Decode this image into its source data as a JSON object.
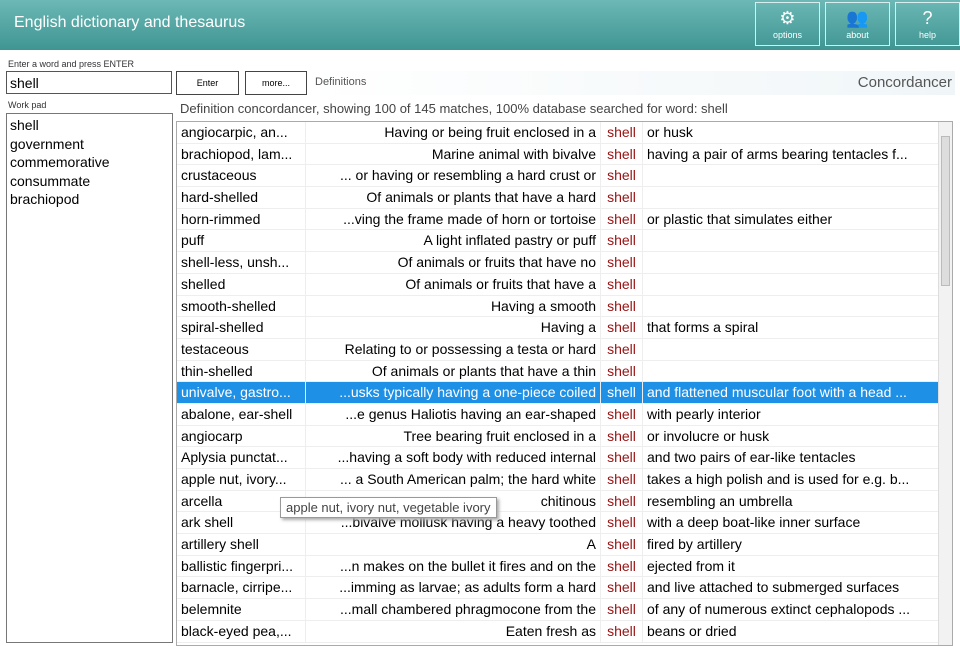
{
  "app": {
    "title": "English dictionary and thesaurus"
  },
  "header_buttons": [
    {
      "label": "options",
      "icon": "gear-icon",
      "glyph": "⚙"
    },
    {
      "label": "about",
      "icon": "users-icon",
      "glyph": "👥"
    },
    {
      "label": "help",
      "icon": "help-icon",
      "glyph": "?"
    }
  ],
  "search": {
    "label": "Enter a word and press ENTER",
    "value": "shell",
    "enter_label": "Enter",
    "more_label": "more..."
  },
  "mode": {
    "definitions": "Definitions",
    "concordancer": "Concordancer"
  },
  "workpad": {
    "label": "Work pad",
    "items": [
      "shell",
      "government",
      "commemorative",
      "consummate",
      "brachiopod"
    ]
  },
  "status": "Definition concordancer, showing 100 of 145 matches, 100% database searched for word: shell",
  "tooltip": "apple nut, ivory nut, vegetable ivory",
  "rows": [
    [
      "angiocarpic, an...",
      "Having or being fruit enclosed in a",
      "shell",
      "or husk"
    ],
    [
      "brachiopod, lam...",
      "Marine animal with bivalve",
      "shell",
      "having a pair of arms bearing tentacles f..."
    ],
    [
      "crustaceous",
      "... or having or resembling a hard crust or",
      "shell",
      ""
    ],
    [
      "hard-shelled",
      "Of animals or plants that have a hard",
      "shell",
      ""
    ],
    [
      "horn-rimmed",
      "...ving the frame made of horn or tortoise",
      "shell",
      "or plastic that simulates either"
    ],
    [
      "puff",
      "A light inflated pastry or puff",
      "shell",
      ""
    ],
    [
      "shell-less, unsh...",
      "Of animals or fruits that have no",
      "shell",
      ""
    ],
    [
      "shelled",
      "Of animals or fruits that have a",
      "shell",
      ""
    ],
    [
      "smooth-shelled",
      "Having a smooth",
      "shell",
      ""
    ],
    [
      "spiral-shelled",
      "Having a",
      "shell",
      "that forms a spiral"
    ],
    [
      "testaceous",
      "Relating to or possessing a testa or hard",
      "shell",
      ""
    ],
    [
      "thin-shelled",
      "Of animals or plants that have a thin",
      "shell",
      ""
    ],
    [
      "univalve, gastro...",
      "...usks typically having a one-piece coiled",
      "shell",
      "and flattened muscular foot with a head ..."
    ],
    [
      "abalone, ear-shell",
      "...e genus Haliotis having an ear-shaped",
      "shell",
      "with pearly interior"
    ],
    [
      "angiocarp",
      "Tree bearing fruit enclosed in a",
      "shell",
      "or involucre or husk"
    ],
    [
      "Aplysia punctat...",
      "...having a soft body with reduced internal",
      "shell",
      "and two pairs of ear-like tentacles"
    ],
    [
      "apple nut, ivory...",
      "... a South American palm; the hard white",
      "shell",
      "takes a high polish and is used for e.g. b..."
    ],
    [
      "arcella",
      "chitinous",
      "shell",
      "resembling an umbrella"
    ],
    [
      "ark shell",
      "...bivalve mollusk having a heavy toothed",
      "shell",
      "with a deep boat-like inner surface"
    ],
    [
      "artillery shell",
      "A",
      "shell",
      "fired by artillery"
    ],
    [
      "ballistic fingerpri...",
      "...n makes on the bullet it fires and on the",
      "shell",
      "ejected from it"
    ],
    [
      "barnacle, cirripe...",
      "...imming as larvae; as adults form a hard",
      "shell",
      "and live attached to submerged surfaces"
    ],
    [
      "belemnite",
      "...mall chambered phragmocone from the",
      "shell",
      "of any of numerous extinct cephalopods ..."
    ],
    [
      "black-eyed pea,...",
      "Eaten fresh as",
      "shell",
      "beans or dried"
    ]
  ],
  "selected_row": 12,
  "colors": {
    "header": "#4fa5a3",
    "selection": "#1e90e6",
    "keyword": "#9a1010"
  }
}
